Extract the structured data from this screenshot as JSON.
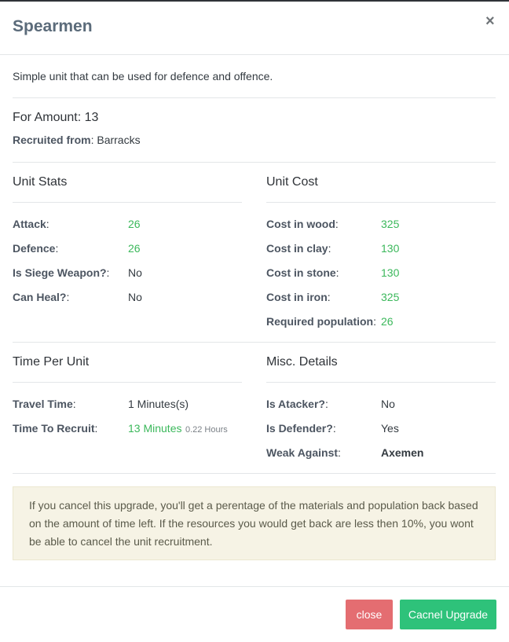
{
  "modal": {
    "title": "Spearmen",
    "close_icon": "×"
  },
  "description": "Simple unit that can be used for defence and offence.",
  "amount": {
    "text": "For Amount: 13"
  },
  "recruited": {
    "label": "Recruited from",
    "sep": ":",
    "value": " Barracks"
  },
  "unit_stats": {
    "heading": "Unit Stats",
    "rows": [
      {
        "label": "Attack",
        "value": "26"
      },
      {
        "label": "Defence",
        "value": "26"
      },
      {
        "label": "Is Siege Weapon?",
        "value": "No"
      },
      {
        "label": "Can Heal?",
        "value": "No"
      }
    ]
  },
  "unit_cost": {
    "heading": "Unit Cost",
    "rows": [
      {
        "label": "Cost in wood",
        "value": "325"
      },
      {
        "label": "Cost in clay",
        "value": "130"
      },
      {
        "label": "Cost in stone",
        "value": "130"
      },
      {
        "label": "Cost in iron",
        "value": "325"
      },
      {
        "label": "Required population",
        "value": "26"
      }
    ]
  },
  "time_per_unit": {
    "heading": "Time Per Unit",
    "travel": {
      "label": "Travel Time",
      "value": "1 Minutes(s)"
    },
    "recruit": {
      "label": "Time To Recruit",
      "value": "13 Minutes",
      "extra": "0.22 Hours"
    }
  },
  "misc": {
    "heading": "Misc. Details",
    "rows": [
      {
        "label": "Is Atacker?",
        "value": "No"
      },
      {
        "label": "Is Defender?",
        "value": "Yes"
      },
      {
        "label": "Weak Against",
        "value": "Axemen"
      }
    ]
  },
  "notice": "If you cancel this upgrade, you'll get a perentage of the materials and population back based on the amount of time left. If the resources you would get back are less then 10%, you wont be able to cancel the unit recruitment.",
  "buttons": {
    "close": "close",
    "cancel_upgrade": "Cacnel Upgrade"
  },
  "colors": {
    "green_value": "#3bb85b",
    "close_button": "#e46d71",
    "cancel_button": "#2ec27a",
    "notice_bg": "#f6f3e5"
  }
}
